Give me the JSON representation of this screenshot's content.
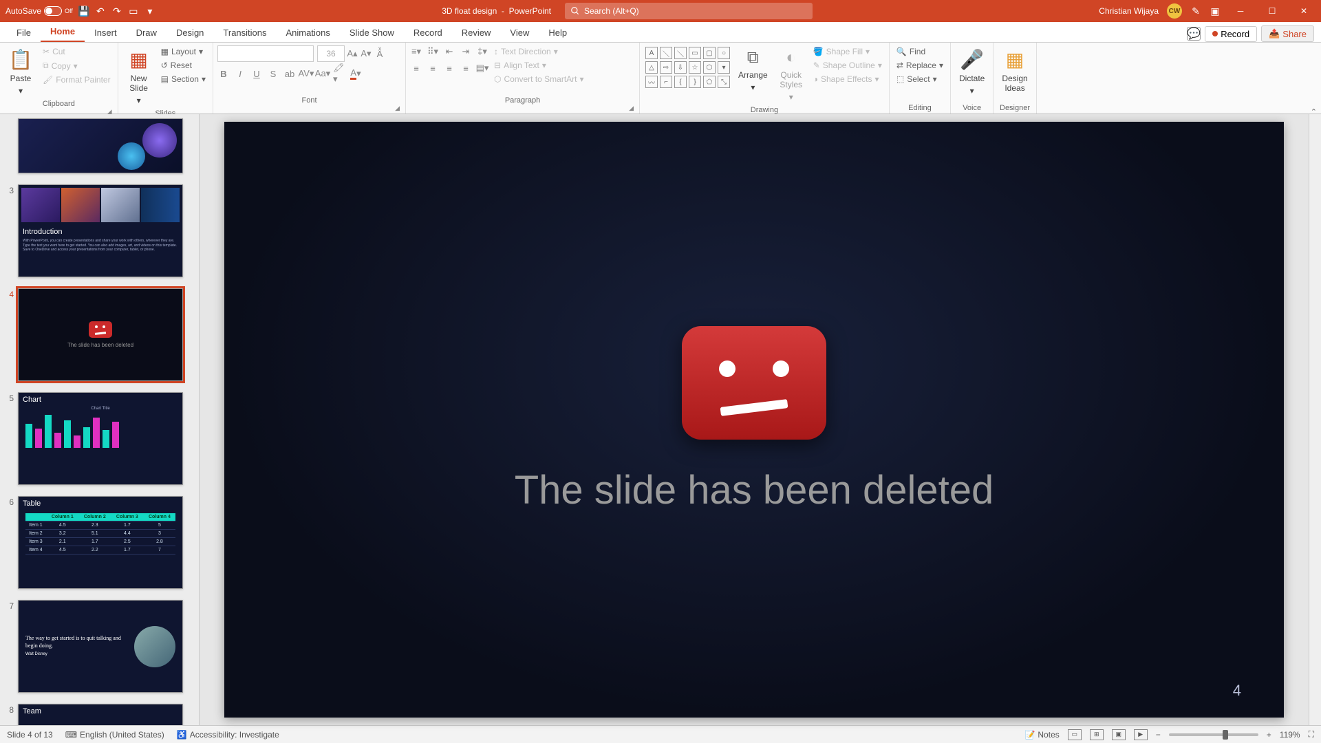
{
  "titleBar": {
    "autosave": "AutoSave",
    "autosaveState": "Off",
    "docName": "3D float design",
    "appName": "PowerPoint",
    "searchPlaceholder": "Search (Alt+Q)",
    "userName": "Christian Wijaya",
    "userInitials": "CW"
  },
  "tabs": {
    "file": "File",
    "home": "Home",
    "insert": "Insert",
    "draw": "Draw",
    "design": "Design",
    "transitions": "Transitions",
    "animations": "Animations",
    "slideShow": "Slide Show",
    "record": "Record",
    "review": "Review",
    "view": "View",
    "help": "Help",
    "recordBtn": "Record",
    "share": "Share"
  },
  "ribbon": {
    "clipboard": {
      "label": "Clipboard",
      "paste": "Paste",
      "cut": "Cut",
      "copy": "Copy",
      "formatPainter": "Format Painter"
    },
    "slides": {
      "label": "Slides",
      "newSlide": "New\nSlide",
      "layout": "Layout",
      "reset": "Reset",
      "section": "Section"
    },
    "font": {
      "label": "Font",
      "size": "36"
    },
    "paragraph": {
      "label": "Paragraph",
      "textDirection": "Text Direction",
      "alignText": "Align Text",
      "convertSmartArt": "Convert to SmartArt"
    },
    "drawing": {
      "label": "Drawing",
      "arrange": "Arrange",
      "quickStyles": "Quick\nStyles",
      "shapeFill": "Shape Fill",
      "shapeOutline": "Shape Outline",
      "shapeEffects": "Shape Effects"
    },
    "editing": {
      "label": "Editing",
      "find": "Find",
      "replace": "Replace",
      "select": "Select"
    },
    "voice": {
      "label": "Voice",
      "dictate": "Dictate"
    },
    "designer": {
      "label": "Designer",
      "designIdeas": "Design\nIdeas"
    }
  },
  "thumbs": {
    "n3": "3",
    "n4": "4",
    "n5": "5",
    "n6": "6",
    "n7": "7",
    "n8": "8",
    "introTitle": "Introduction",
    "introBody": "With PowerPoint, you can create presentations and share your work with others, wherever they are. Type the text you want here to get started. You can also add images, art, and videos on this template. Save to OneDrive and access your presentations from your computer, tablet, or phone.",
    "deletedThumb": "The slide has been deleted",
    "chartTitle": "Chart",
    "chartSub": "Chart Title",
    "tableTitle": "Table",
    "quote": "The way to get started is to quit talking and begin doing.",
    "quoteBy": "Walt Disney",
    "teamTitle": "Team"
  },
  "slide": {
    "deletedText": "The slide has been deleted",
    "number": "4"
  },
  "status": {
    "slideCount": "Slide 4 of 13",
    "language": "English (United States)",
    "accessibility": "Accessibility: Investigate",
    "notes": "Notes",
    "zoom": "119%"
  }
}
